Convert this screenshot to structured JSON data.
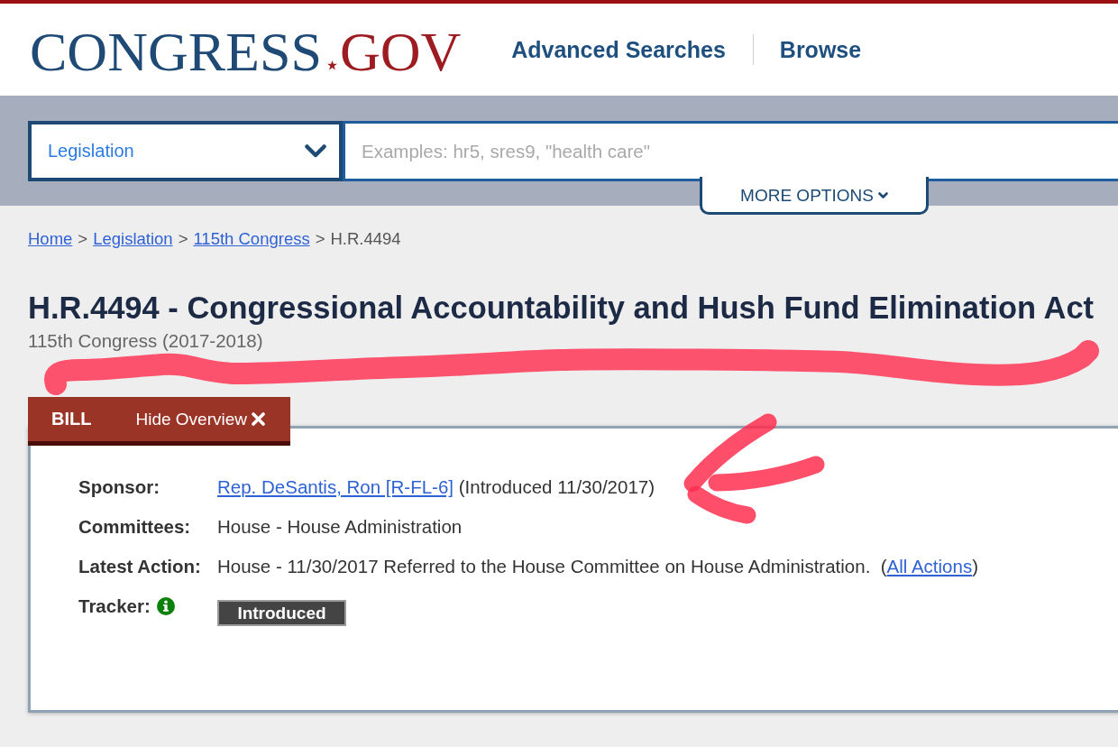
{
  "header": {
    "logo": {
      "primary": "CONGRESS",
      "secondary": "GOV"
    },
    "nav": [
      "Advanced Searches",
      "Browse"
    ]
  },
  "search": {
    "category": "Legislation",
    "placeholder": "Examples: hr5, sres9, \"health care\"",
    "more_options": "MORE OPTIONS"
  },
  "breadcrumb": [
    {
      "kind": "link",
      "label": "Home"
    },
    {
      "kind": "separator",
      "label": ">"
    },
    {
      "kind": "link",
      "label": "Legislation"
    },
    {
      "kind": "separator",
      "label": ">"
    },
    {
      "kind": "link",
      "label": "115th Congress"
    },
    {
      "kind": "separator",
      "label": ">"
    },
    {
      "kind": "current",
      "label": "H.R.4494"
    }
  ],
  "title": "H.R.4494 - Congressional Accountability and Hush Fund Elimination Act",
  "subtitle": "115th Congress (2017-2018)",
  "overview": {
    "type_label": "BILL",
    "toggle": "Hide Overview",
    "rows": [
      {
        "kind": "link_text",
        "label": "Sponsor:",
        "link": "Rep. DeSantis, Ron [R-FL-6]",
        "text": "(Introduced 11/30/2017)"
      },
      {
        "kind": "text",
        "label": "Committees:",
        "text": "House - House Administration"
      },
      {
        "kind": "text_link",
        "label": "Latest Action:",
        "text": "House - 11/30/2017 Referred to the House Committee on House Administration.  (",
        "link": "All Actions",
        "text_after": ")"
      },
      {
        "kind": "tracker",
        "label": "Tracker:",
        "status": "Introduced"
      }
    ]
  },
  "hand_markup": {
    "underline": true,
    "arrow": true
  }
}
